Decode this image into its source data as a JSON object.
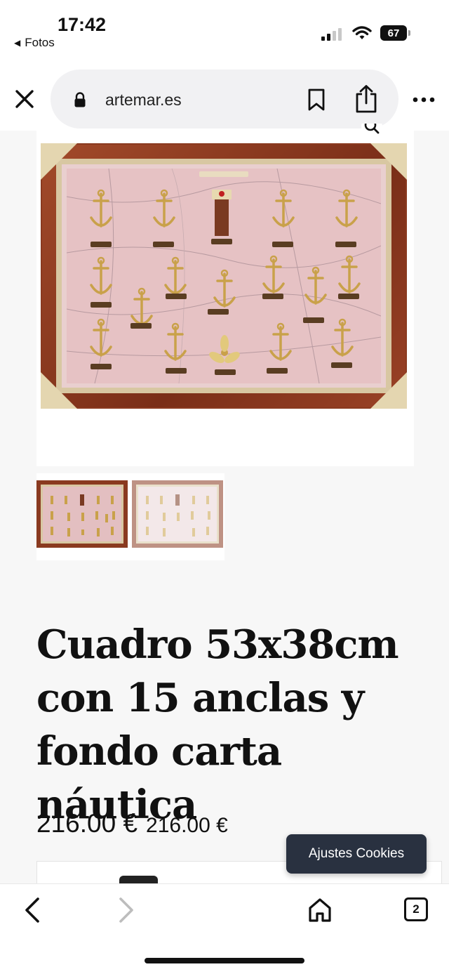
{
  "status_bar": {
    "time": "17:42",
    "back_app": "Fotos",
    "battery": "67"
  },
  "browser": {
    "url": "artemar.es",
    "icons": [
      "close-icon",
      "lock-icon",
      "bookmark-icon",
      "share-icon",
      "more-icon",
      "zoom-icon"
    ]
  },
  "product": {
    "title_lines": [
      "Cuadro 53x38cm",
      "con 15 anclas y",
      "fondo carta náutica"
    ],
    "price": "216.00 €",
    "price_secondary": "216.00 €",
    "thumbnail_count": 2
  },
  "cookie_button": "Ajustes Cookies",
  "toolbar": {
    "tab_count": "2",
    "icons": [
      "chevron-left-icon",
      "chevron-right-icon",
      "home-icon",
      "tabs-icon"
    ]
  },
  "colors": {
    "frame_wood": "#8a3a20",
    "chart_pink": "#e6c2c4",
    "cookie_bg": "#293140",
    "url_pill": "#f1f1f3"
  }
}
